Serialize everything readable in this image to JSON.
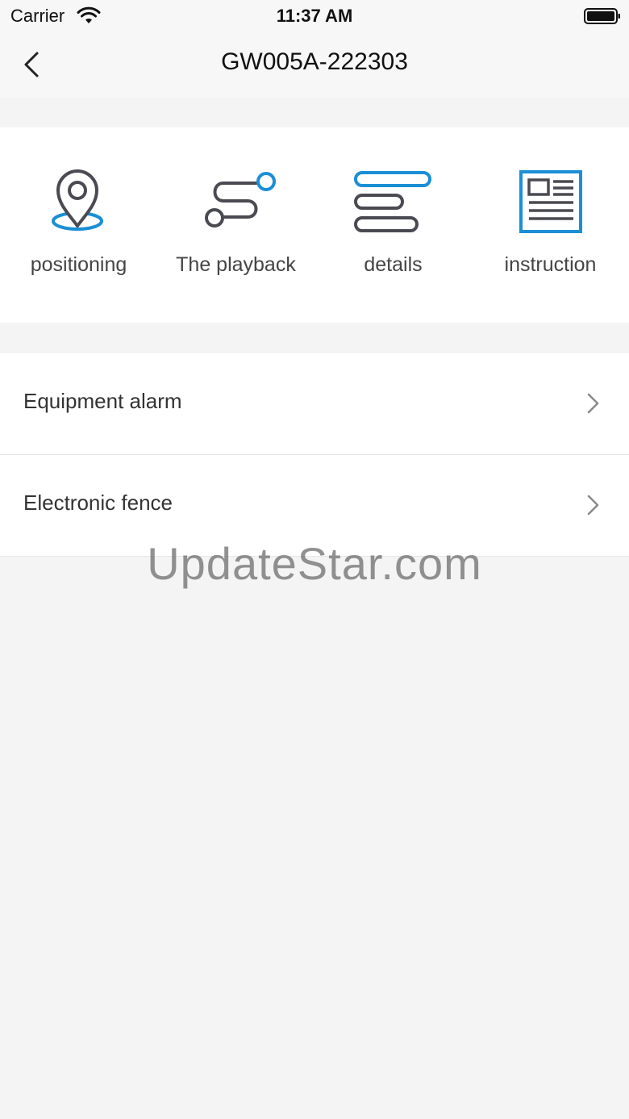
{
  "status_bar": {
    "carrier": "Carrier",
    "time": "11:37 AM",
    "wifi_icon": "wifi-icon",
    "battery_icon": "battery-icon"
  },
  "nav": {
    "title": "GW005A-222303",
    "back_icon": "chevron-left-icon"
  },
  "quick_actions": [
    {
      "label": "positioning",
      "icon": "location-pin-icon"
    },
    {
      "label": "The playback",
      "icon": "route-icon"
    },
    {
      "label": "details",
      "icon": "list-bars-icon"
    },
    {
      "label": "instruction",
      "icon": "document-icon"
    }
  ],
  "menu": [
    {
      "label": "Equipment alarm",
      "icon": "chevron-right-icon"
    },
    {
      "label": "Electronic fence",
      "icon": "chevron-right-icon"
    }
  ],
  "watermark": "UpdateStar.com",
  "colors": {
    "accent": "#1a8fd6",
    "icon_dark": "#4a4a52",
    "background": "#f4f4f4"
  }
}
